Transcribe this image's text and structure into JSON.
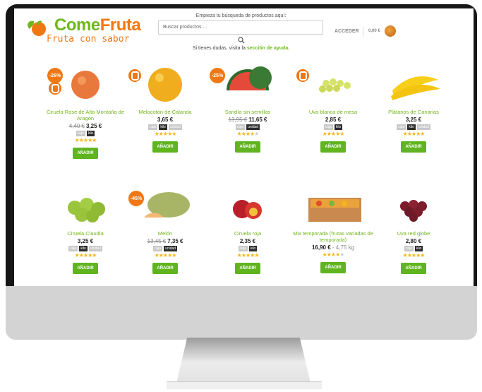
{
  "header": {
    "logo_main": "Come",
    "logo_accent": "Fruta",
    "logo_tagline": "Fruta con sabor",
    "search_hint": "Empieza tu búsqueda de productos aquí:",
    "search_placeholder": "Buscar productos ...",
    "help_text": "Si tienes dudas, visita la ",
    "help_link": "sección de ayuda.",
    "login": "ACCEDER",
    "cart_total": "0,00 €"
  },
  "colors": {
    "green": "#73b51d",
    "orange": "#f07814",
    "button": "#5fb420"
  },
  "products": [
    {
      "name": "Ciruela Rose de Alta Montaña de Aragón",
      "old": "4,40 €",
      "price": "3,25 €",
      "units": [
        "caja",
        "kilo"
      ],
      "active": "kilo",
      "stars": 5,
      "button": "AÑADIR",
      "badge": "-26%"
    },
    {
      "name": "Melocotón de Calanda",
      "old": "",
      "price": "3,65 €",
      "units": [
        "caja",
        "kilo",
        "unidad"
      ],
      "active": "kilo",
      "stars": 5,
      "button": "AÑADIR",
      "badge": ""
    },
    {
      "name": "Sandía sin semillas",
      "old": "13,95 €",
      "price": "11,65 €",
      "units": [
        "caja",
        "unidad"
      ],
      "active": "unidad",
      "stars": 4,
      "button": "AÑADIR",
      "badge": "-25%"
    },
    {
      "name": "Uva blanca de mesa",
      "old": "",
      "price": "2,85 €",
      "units": [
        "caja",
        "kilo"
      ],
      "active": "kilo",
      "stars": 5,
      "button": "AÑADIR",
      "badge": ""
    },
    {
      "name": "Plátanos de Canarias",
      "old": "",
      "price": "3,25 €",
      "units": [
        "caja",
        "kilo",
        "unidad"
      ],
      "active": "kilo",
      "stars": 5,
      "button": "AÑADIR",
      "badge": ""
    },
    {
      "name": "Ciruela Claudia",
      "old": "",
      "price": "3,25 €",
      "units": [
        "caja",
        "kilo",
        "unidad"
      ],
      "active": "kilo",
      "stars": 5,
      "button": "AÑADIR",
      "badge": ""
    },
    {
      "name": "Melón",
      "old": "13,45 €",
      "price": "7,35 €",
      "units": [
        "caja",
        "unidad"
      ],
      "active": "unidad",
      "stars": 5,
      "button": "AÑADIR",
      "badge": "-45%"
    },
    {
      "name": "Ciruela roja",
      "old": "",
      "price": "2,35 €",
      "units": [
        "caja",
        "kilo"
      ],
      "active": "kilo",
      "stars": 5,
      "button": "AÑADIR",
      "badge": ""
    },
    {
      "name": "Mix temporada (frutas variadas de temporada)",
      "old": "",
      "price": "16,90 €",
      "sub": "4,75 kg",
      "units": [],
      "active": "",
      "stars": 4,
      "button": "AÑADIR",
      "badge": ""
    },
    {
      "name": "Uva red globe",
      "old": "",
      "price": "2,80 €",
      "units": [
        "caja",
        "kilo"
      ],
      "active": "kilo",
      "stars": 5,
      "button": "AÑADIR",
      "badge": ""
    }
  ]
}
